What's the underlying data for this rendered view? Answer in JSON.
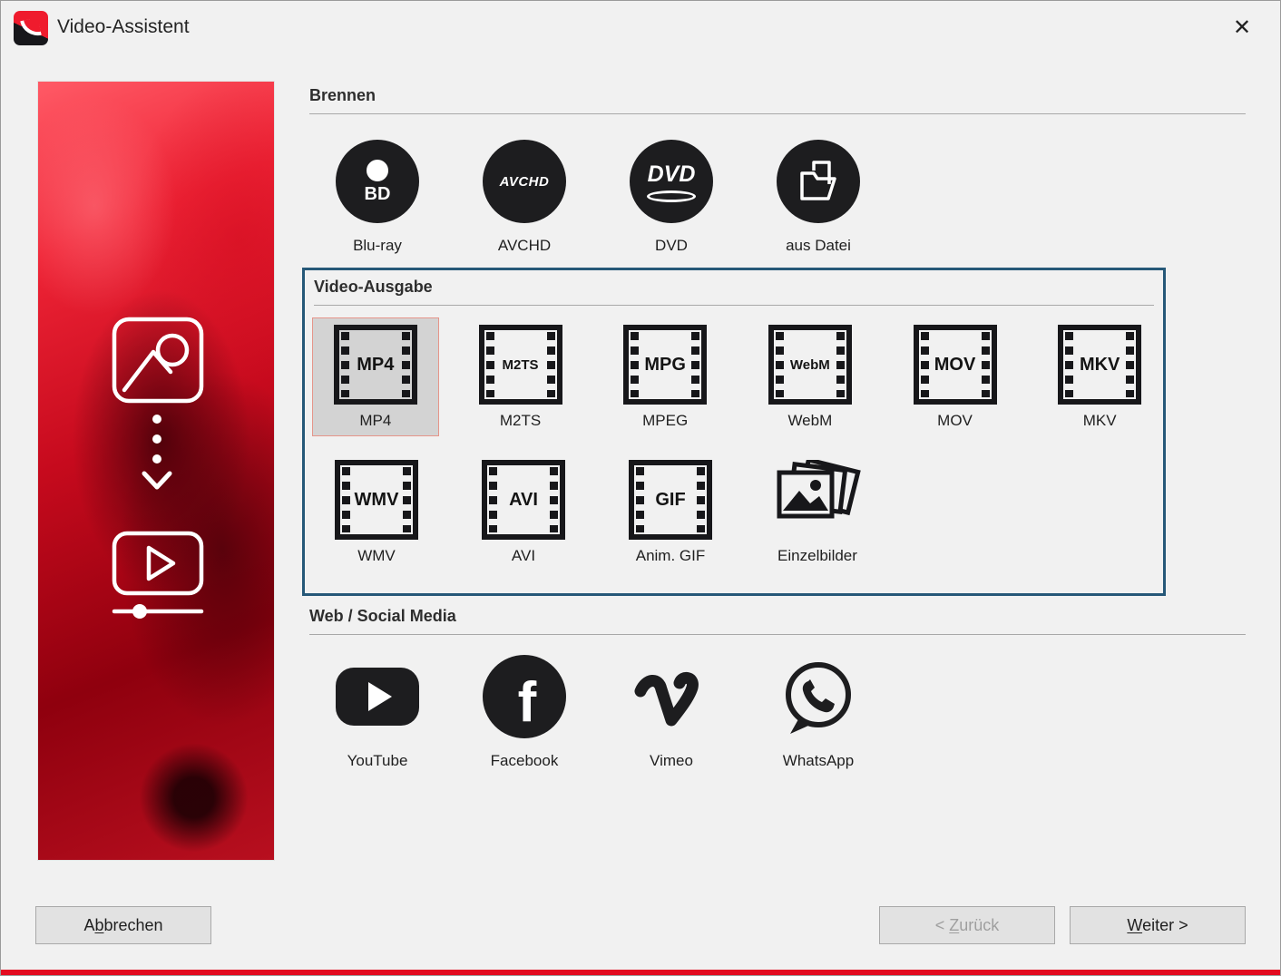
{
  "window": {
    "title": "Video-Assistent",
    "close_glyph": "✕"
  },
  "colors": {
    "accent_red": "#e30b20",
    "panel_border_blue": "#265878",
    "selected_item_border": "#e5958a",
    "selected_item_bg": "#d3d3d3",
    "icon_black": "#1d1d1f"
  },
  "sections": {
    "brennen": {
      "title": "Brennen",
      "items": [
        {
          "label": "Blu-ray",
          "icon": "bluray-disc-icon",
          "icon_text": "BD"
        },
        {
          "label": "AVCHD",
          "icon": "avchd-disc-icon",
          "icon_text": "AVCHD"
        },
        {
          "label": "DVD",
          "icon": "dvd-disc-icon",
          "icon_text": "DVD"
        },
        {
          "label": "aus Datei",
          "icon": "from-file-icon"
        }
      ]
    },
    "video_ausgabe": {
      "title": "Video-Ausgabe",
      "selected": "MP4",
      "items": [
        {
          "label": "MP4",
          "icon_text": "MP4",
          "selected": true
        },
        {
          "label": "M2TS",
          "icon_text": "M2TS",
          "selected": false
        },
        {
          "label": "MPEG",
          "icon_text": "MPG",
          "selected": false
        },
        {
          "label": "WebM",
          "icon_text": "WebM",
          "selected": false
        },
        {
          "label": "MOV",
          "icon_text": "MOV",
          "selected": false
        },
        {
          "label": "MKV",
          "icon_text": "MKV",
          "selected": false
        },
        {
          "label": "WMV",
          "icon_text": "WMV",
          "selected": false
        },
        {
          "label": "AVI",
          "icon_text": "AVI",
          "selected": false
        },
        {
          "label": "Anim. GIF",
          "icon_text": "GIF",
          "selected": false
        },
        {
          "label": "Einzelbilder",
          "icon": "image-stack-icon",
          "selected": false
        }
      ]
    },
    "web_social": {
      "title": "Web / Social Media",
      "items": [
        {
          "label": "YouTube",
          "icon": "youtube-icon"
        },
        {
          "label": "Facebook",
          "icon": "facebook-icon",
          "icon_text": "f"
        },
        {
          "label": "Vimeo",
          "icon": "vimeo-icon"
        },
        {
          "label": "WhatsApp",
          "icon": "whatsapp-icon"
        }
      ]
    }
  },
  "buttons": {
    "cancel": {
      "pre": "A",
      "key": "b",
      "post": "brechen"
    },
    "back": {
      "pre": "< ",
      "key": "Z",
      "post": "urück",
      "disabled": true
    },
    "next": {
      "pre": "",
      "key": "W",
      "post": "eiter >",
      "disabled": false
    }
  }
}
